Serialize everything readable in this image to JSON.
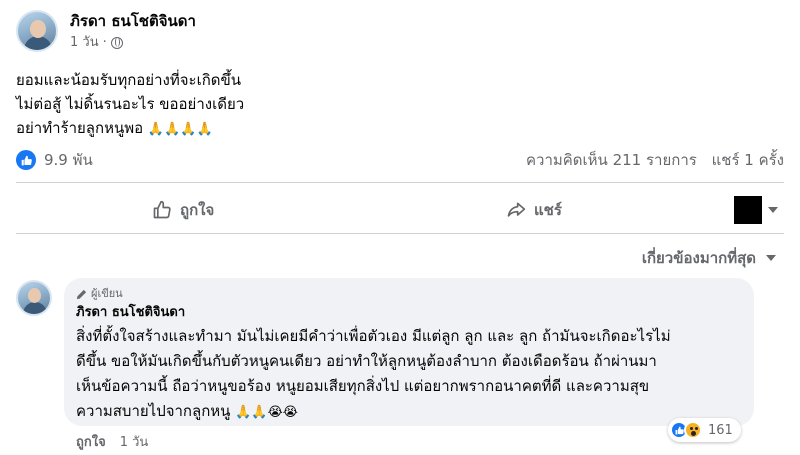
{
  "post": {
    "author": "ภิรดา ธนโชติจินดา",
    "time": "1 วัน",
    "privacy_icon": "globe-icon",
    "lines": [
      "ยอมและน้อมรับทุกอย่างที่จะเกิดขึ้น",
      "ไม่ต่อสู้ ไม่ดิ้นรนอะไร ขออย่างเดียว",
      "อย่าทำร้ายลูกหนูพอ"
    ],
    "line3_emoji": "🙏🙏🙏🙏",
    "like_count": "9.9 พัน",
    "comments_count": "ความคิดเห็น 211 รายการ",
    "shares_count": "แชร์ 1 ครั้ง"
  },
  "actions": {
    "like_label": "ถูกใจ",
    "share_label": "แชร์"
  },
  "sort": {
    "label": "เกี่ยวข้องมากที่สุด"
  },
  "comment": {
    "badge": "ผู้เขียน",
    "author": "ภิรดา ธนโชติจินดา",
    "lines": [
      "สิ่งที่ตั้งใจสร้างและทำมา มันไม่เคยมีคำว่าเพื่อตัวเอง มีแต่ลูก ลูก และ ลูก ถ้ามันจะเกิดอะไรไม่",
      "ดีขึ้น ขอให้มันเกิดขึ้นกับตัวหนูคนเดียว อย่าทำให้ลูกหนูต้องลำบาก ต้องเดือดร้อน ถ้าผ่านมา",
      "เห็นข้อความนี้ ถือว่าหนูขอร้อง หนูยอมเสียทุกสิ่งไป แต่อยากพรากอนาคตที่ดี และความสุข",
      "ความสบายไปจากลูกหนู"
    ],
    "line4_emoji": "🙏🙏😭😭",
    "like_label": "ถูกใจ",
    "time": "1 วัน",
    "reaction_count": "161"
  },
  "colors": {
    "accent": "#1877f2",
    "secondary_text": "#65676b",
    "bubble_bg": "#f0f2f5"
  }
}
